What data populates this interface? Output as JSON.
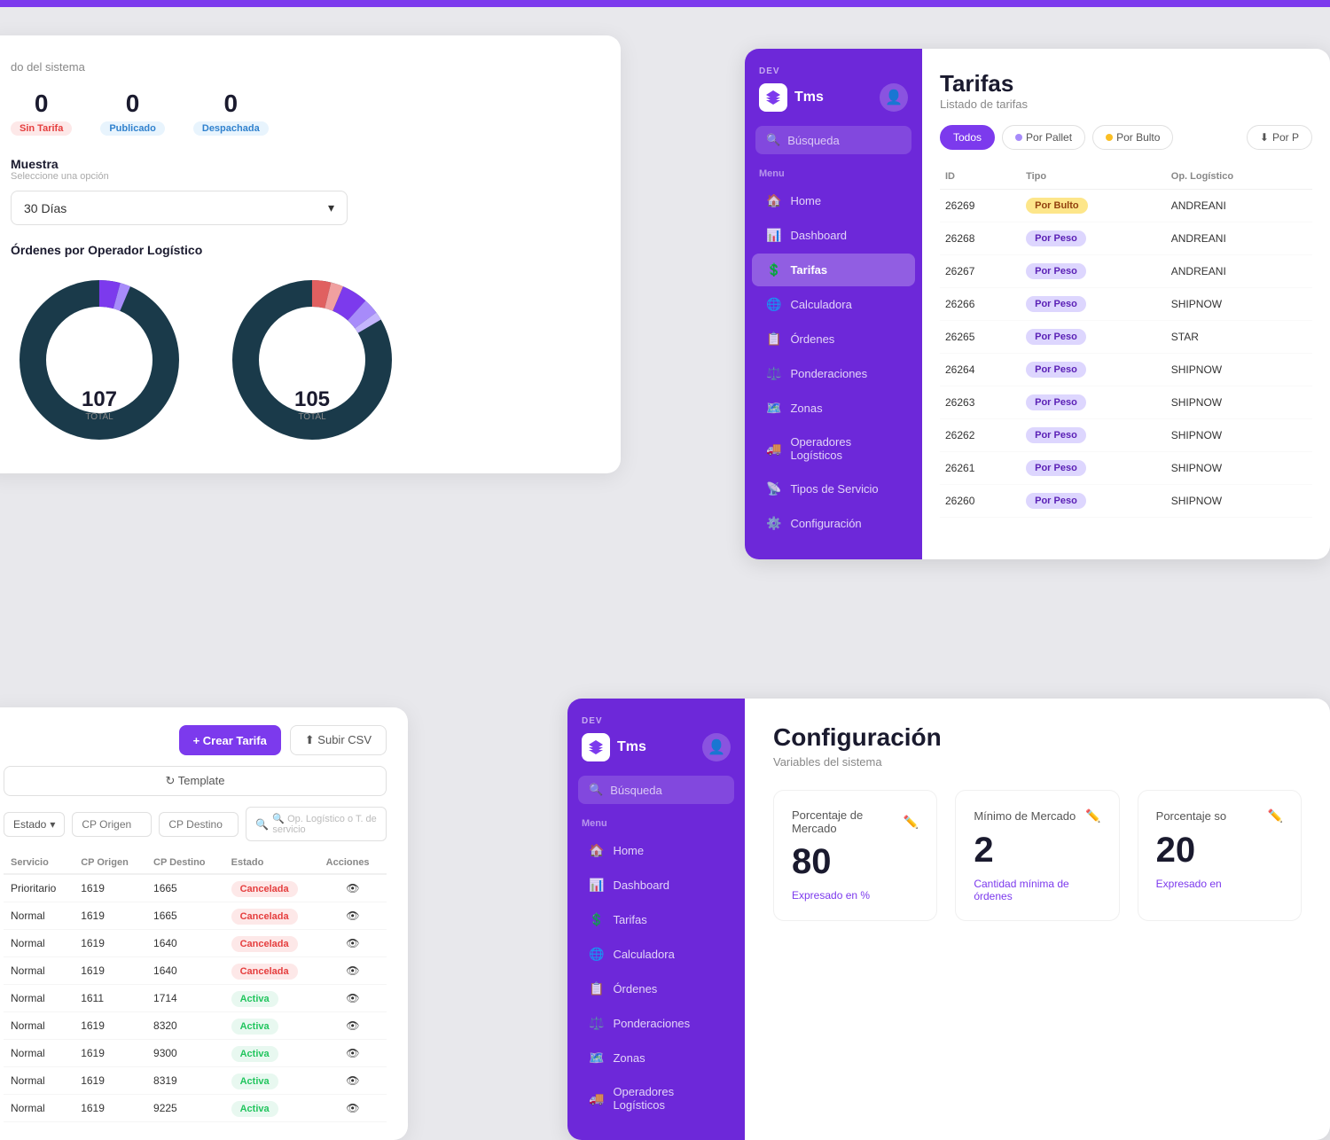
{
  "topBar": {},
  "dashboard": {
    "systemLabel": "do del sistema",
    "stats": [
      {
        "value": "0",
        "badgeLabel": "Sin Tarifa",
        "badgeClass": "badge-sin-tarifa"
      },
      {
        "value": "0",
        "badgeLabel": "Publicado",
        "badgeClass": "badge-publicado"
      },
      {
        "value": "0",
        "badgeLabel": "Despachada",
        "badgeClass": "badge-despachada"
      }
    ],
    "muestra": {
      "title": "Muestra",
      "subtitle": "Seleccione una opción",
      "selectValue": "30 Días"
    },
    "chartTitle": "Órdenes por Operador Logístico",
    "donut1": {
      "total": "107",
      "label": "TOTAL"
    },
    "donut2": {
      "total": "105",
      "label": "TOTAL"
    }
  },
  "tarifas": {
    "devLabel": "DEV",
    "logoText": "Tms",
    "searchPlaceholder": "Búsqueda",
    "menuLabel": "Menu",
    "navItems": [
      {
        "label": "Home",
        "icon": "🏠",
        "active": false
      },
      {
        "label": "Dashboard",
        "icon": "📊",
        "active": false
      },
      {
        "label": "Tarifas",
        "icon": "$",
        "active": true
      },
      {
        "label": "Calculadora",
        "icon": "🌐",
        "active": false
      },
      {
        "label": "Órdenes",
        "icon": "📋",
        "active": false
      },
      {
        "label": "Ponderaciones",
        "icon": "⚖️",
        "active": false
      },
      {
        "label": "Zonas",
        "icon": "🗺️",
        "active": false
      },
      {
        "label": "Operadores Logísticos",
        "icon": "🚚",
        "active": false
      },
      {
        "label": "Tipos de Servicio",
        "icon": "📡",
        "active": false
      },
      {
        "label": "Configuración",
        "icon": "⚙️",
        "active": false
      }
    ],
    "pageTitle": "Tarifas",
    "pageSubtitle": "Listado de tarifas",
    "filters": [
      {
        "label": "Todos",
        "active": true
      },
      {
        "label": "Por Pallet",
        "active": false
      },
      {
        "label": "Por Bulto",
        "active": false
      },
      {
        "label": "Por P",
        "active": false
      }
    ],
    "tableHeaders": [
      "ID",
      "Tipo",
      "Op. Logístico"
    ],
    "tableRows": [
      {
        "id": "26269",
        "tipo": "Por Bulto",
        "tipoClass": "tipo-bulto",
        "op": "ANDREANI"
      },
      {
        "id": "26268",
        "tipo": "Por Peso",
        "tipoClass": "tipo-peso",
        "op": "ANDREANI"
      },
      {
        "id": "26267",
        "tipo": "Por Peso",
        "tipoClass": "tipo-peso",
        "op": "ANDREANI"
      },
      {
        "id": "26266",
        "tipo": "Por Peso",
        "tipoClass": "tipo-peso",
        "op": "SHIPNOW"
      },
      {
        "id": "26265",
        "tipo": "Por Peso",
        "tipoClass": "tipo-peso",
        "op": "STAR"
      },
      {
        "id": "26264",
        "tipo": "Por Peso",
        "tipoClass": "tipo-peso",
        "op": "SHIPNOW"
      },
      {
        "id": "26263",
        "tipo": "Por Peso",
        "tipoClass": "tipo-peso",
        "op": "SHIPNOW"
      },
      {
        "id": "26262",
        "tipo": "Por Peso",
        "tipoClass": "tipo-peso",
        "op": "SHIPNOW"
      },
      {
        "id": "26261",
        "tipo": "Por Peso",
        "tipoClass": "tipo-peso",
        "op": "SHIPNOW"
      },
      {
        "id": "26260",
        "tipo": "Por Peso",
        "tipoClass": "tipo-peso",
        "op": "SHIPNOW"
      }
    ]
  },
  "tarifaList": {
    "btnCrear": "+ Crear Tarifa",
    "btnSubir": "⬆ Subir CSV",
    "btnTemplate": "↻ Template",
    "filterOptions": [
      "Estado"
    ],
    "placeholder1": "CP Origen",
    "placeholder2": "CP Destino",
    "placeholder3": "🔍 Op. Logístico o T. de servicio",
    "tableHeaders": [
      "Servicio",
      "CP Origen",
      "CP Destino",
      "Estado",
      "Acciones"
    ],
    "tableRows": [
      {
        "servicio": "Prioritario",
        "cpOrigen": "1619",
        "cpDestino": "1665",
        "estado": "Cancelada",
        "estadoClass": "estado-cancelada"
      },
      {
        "servicio": "Normal",
        "cpOrigen": "1619",
        "cpDestino": "1665",
        "estado": "Cancelada",
        "estadoClass": "estado-cancelada"
      },
      {
        "servicio": "Normal",
        "cpOrigen": "1619",
        "cpDestino": "1640",
        "estado": "Cancelada",
        "estadoClass": "estado-cancelada"
      },
      {
        "servicio": "Normal",
        "cpOrigen": "1619",
        "cpDestino": "1640",
        "estado": "Cancelada",
        "estadoClass": "estado-cancelada"
      },
      {
        "servicio": "Normal",
        "cpOrigen": "1611",
        "cpDestino": "1714",
        "estado": "Activa",
        "estadoClass": "estado-activa"
      },
      {
        "servicio": "Normal",
        "cpOrigen": "1619",
        "cpDestino": "8320",
        "estado": "Activa",
        "estadoClass": "estado-activa"
      },
      {
        "servicio": "Normal",
        "cpOrigen": "1619",
        "cpDestino": "9300",
        "estado": "Activa",
        "estadoClass": "estado-activa"
      },
      {
        "servicio": "Normal",
        "cpOrigen": "1619",
        "cpDestino": "8319",
        "estado": "Activa",
        "estadoClass": "estado-activa"
      },
      {
        "servicio": "Normal",
        "cpOrigen": "1619",
        "cpDestino": "9225",
        "estado": "Activa",
        "estadoClass": "estado-activa"
      }
    ]
  },
  "configuracion": {
    "devLabel": "DEV",
    "logoText": "Tms",
    "searchPlaceholder": "Búsqueda",
    "menuLabel": "Menu",
    "navItems": [
      {
        "label": "Home",
        "icon": "🏠",
        "active": false
      },
      {
        "label": "Dashboard",
        "icon": "📊",
        "active": false
      },
      {
        "label": "Tarifas",
        "icon": "$",
        "active": false
      },
      {
        "label": "Calculadora",
        "icon": "🌐",
        "active": false
      },
      {
        "label": "Órdenes",
        "icon": "📋",
        "active": false
      },
      {
        "label": "Ponderaciones",
        "icon": "⚖️",
        "active": false
      },
      {
        "label": "Zonas",
        "icon": "🗺️",
        "active": false
      },
      {
        "label": "Operadores Logísticos",
        "icon": "🚚",
        "active": false
      }
    ],
    "pageTitle": "Configuración",
    "pageSubtitle": "Variables del sistema",
    "cards": [
      {
        "label": "Porcentaje de Mercado",
        "value": "80",
        "note": "Expresado en %"
      },
      {
        "label": "Mínimo de Mercado",
        "value": "2",
        "note": "Cantidad mínima de órdenes"
      },
      {
        "label": "Porcentaje so",
        "value": "20",
        "note": "Expresado en"
      }
    ]
  }
}
